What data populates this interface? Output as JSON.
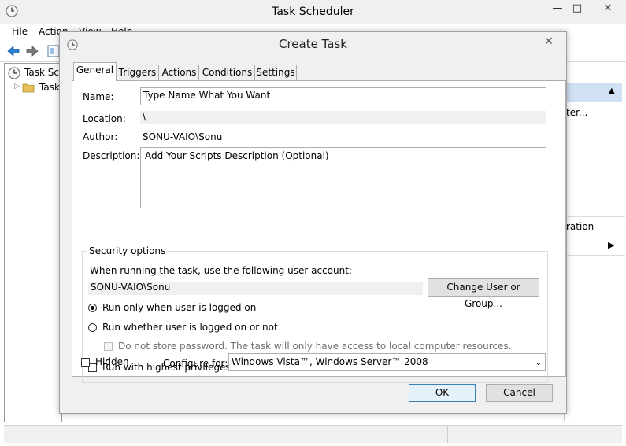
{
  "main_window": {
    "title": "Task Scheduler",
    "controls": {
      "minimize": "—",
      "maximize": "□",
      "close": "✕"
    },
    "menu": [
      "File",
      "Action",
      "View",
      "Help"
    ],
    "tree": {
      "root": "Task Scheduler (Local)",
      "child": "Task Scheduler Library"
    },
    "right_pane": {
      "item1": "ter...",
      "item2": "ration"
    }
  },
  "dialog": {
    "title": "Create Task",
    "close": "✕",
    "tabs": [
      "General",
      "Triggers",
      "Actions",
      "Conditions",
      "Settings"
    ],
    "active_tab": "General",
    "fields": {
      "name_label": "Name:",
      "name_value": "Type Name What You Want",
      "location_label": "Location:",
      "location_value": "\\",
      "author_label": "Author:",
      "author_value": "SONU-VAIO\\Sonu",
      "description_label": "Description:",
      "description_value": "Add Your Scripts Description (Optional)"
    },
    "security": {
      "legend": "Security options",
      "account_prompt": "When running the task, use the following user account:",
      "account_value": "SONU-VAIO\\Sonu",
      "change_button": "Change User or Group...",
      "radio_logged_on": "Run only when user is logged on",
      "radio_logged_on_or_not": "Run whether user is logged on or not",
      "selected_radio": "logged_on",
      "no_store_password": "Do not store password.  The task will only have access to local computer resources.",
      "highest_privileges": "Run with highest privileges"
    },
    "hidden_label": "Hidden",
    "configure_for_label": "Configure for:",
    "configure_for_value": "Windows Vista™, Windows Server™ 2008",
    "ok_button": "OK",
    "cancel_button": "Cancel"
  }
}
